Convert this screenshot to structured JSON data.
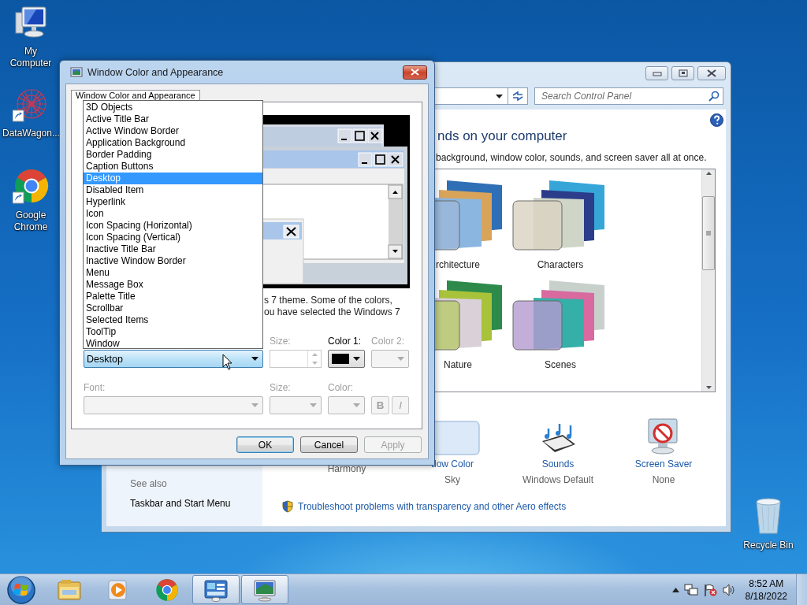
{
  "desktop_icons": [
    {
      "label": "My Computer",
      "kind": "computer",
      "shortcut": false
    },
    {
      "label": "DataWagon...",
      "kind": "mesh",
      "shortcut": true
    },
    {
      "label": "Google Chrome",
      "kind": "chrome",
      "shortcut": true
    }
  ],
  "recycle_bin": {
    "label": "Recycle Bin"
  },
  "control_panel": {
    "search": {
      "placeholder": "Search Control Panel"
    },
    "heading": "nds on your computer",
    "description": "background, window color, sounds, and screen saver all at once.",
    "themes": [
      {
        "name": "rchitecture"
      },
      {
        "name": "Characters"
      },
      {
        "name": "Nature"
      },
      {
        "name": "Scenes"
      }
    ],
    "settings": [
      {
        "kind": "background",
        "value": "Harmony"
      },
      {
        "kind": "color",
        "label": "dow Color",
        "value": "Sky"
      },
      {
        "kind": "sounds",
        "label": "Sounds",
        "value": "Windows Default"
      },
      {
        "kind": "screensaver",
        "label": "Screen Saver",
        "value": "None"
      }
    ],
    "troubleshoot_link": "Troubleshoot problems with transparency and other Aero effects",
    "see_also": {
      "heading": "See also",
      "links": [
        "Taskbar and Start Menu"
      ]
    }
  },
  "dialog": {
    "title": "Window Color and Appearance",
    "tabs": [
      {
        "label": "Window Color and Appearance",
        "selected": true
      }
    ],
    "note_lines": [
      "s 7 theme.  Some of the colors,",
      "ou have selected the Windows 7"
    ],
    "item_list": [
      {
        "label": "3D Objects",
        "selected": false
      },
      {
        "label": "Active Title Bar",
        "selected": false
      },
      {
        "label": "Active Window Border",
        "selected": false
      },
      {
        "label": "Application Background",
        "selected": false
      },
      {
        "label": "Border Padding",
        "selected": false
      },
      {
        "label": "Caption Buttons",
        "selected": false
      },
      {
        "label": "Desktop",
        "selected": true
      },
      {
        "label": "Disabled Item",
        "selected": false
      },
      {
        "label": "Hyperlink",
        "selected": false
      },
      {
        "label": "Icon",
        "selected": false
      },
      {
        "label": "Icon Spacing (Horizontal)",
        "selected": false
      },
      {
        "label": "Icon Spacing (Vertical)",
        "selected": false
      },
      {
        "label": "Inactive Title Bar",
        "selected": false
      },
      {
        "label": "Inactive Window Border",
        "selected": false
      },
      {
        "label": "Menu",
        "selected": false
      },
      {
        "label": "Message Box",
        "selected": false
      },
      {
        "label": "Palette Title",
        "selected": false
      },
      {
        "label": "Scrollbar",
        "selected": false
      },
      {
        "label": "Selected Items",
        "selected": false
      },
      {
        "label": "ToolTip",
        "selected": false
      },
      {
        "label": "Window",
        "selected": false
      }
    ],
    "item": {
      "value": "Desktop"
    },
    "item_size": {
      "label": "Size:",
      "disabled": true
    },
    "color_1": {
      "label": "Color 1:",
      "disabled": false,
      "color": "#000000"
    },
    "color_2": {
      "label": "Color 2:",
      "disabled": true
    },
    "font": {
      "label": "Font:",
      "disabled": true
    },
    "font_size": {
      "label": "Size:",
      "disabled": true
    },
    "font_color": {
      "label": "Color:",
      "disabled": true
    },
    "bold": {
      "label": "B",
      "disabled": true
    },
    "italic": {
      "label": "I",
      "disabled": true
    },
    "buttons": [
      {
        "label": "OK",
        "disabled": false,
        "default": true
      },
      {
        "label": "Cancel",
        "disabled": false,
        "default": false
      },
      {
        "label": "Apply",
        "disabled": true,
        "default": false
      }
    ]
  },
  "taskbar": {
    "items": [
      {
        "kind": "folder",
        "active": false
      },
      {
        "kind": "media",
        "active": false
      },
      {
        "kind": "chrome",
        "active": false
      },
      {
        "kind": "control-panel",
        "active": true
      },
      {
        "kind": "display",
        "active": true
      }
    ],
    "tray": [
      {
        "kind": "arrow"
      },
      {
        "kind": "network"
      },
      {
        "kind": "flag"
      },
      {
        "kind": "speaker"
      }
    ],
    "time": "8:52 AM",
    "date": "8/18/2022"
  }
}
